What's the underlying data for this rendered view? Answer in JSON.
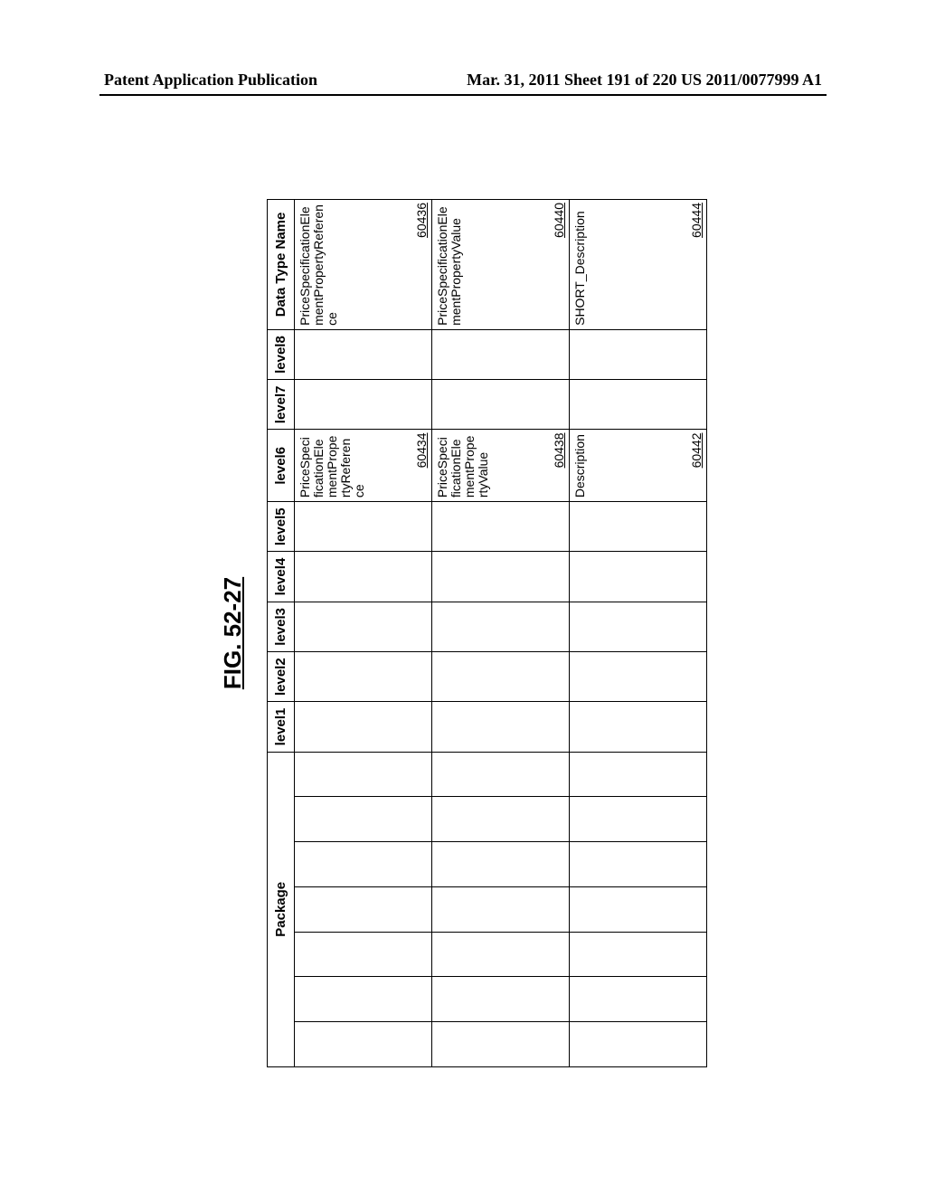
{
  "header": {
    "left": "Patent Application Publication",
    "right": "Mar. 31, 2011  Sheet 191 of 220   US 2011/0077999 A1"
  },
  "figure_title": "FIG. 52-27",
  "columns": {
    "package": "Package",
    "level1": "level1",
    "level2": "level2",
    "level3": "level3",
    "level4": "level4",
    "level5": "level5",
    "level6": "level6",
    "level7": "level7",
    "level8": "level8",
    "data_type_name": "Data Type Name"
  },
  "rows": [
    {
      "level6": {
        "text": "PriceSpecificationElementPropertyReference",
        "ref": "60434"
      },
      "data_type_name": {
        "text": "PriceSpecificationElementPropertyReference",
        "ref": "60436"
      }
    },
    {
      "level6": {
        "text": "PriceSpecificationElementPropertyValue",
        "ref": "60438"
      },
      "data_type_name": {
        "text": "PriceSpecificationElementPropertyValue",
        "ref": "60440"
      }
    },
    {
      "level6": {
        "text": "Description",
        "ref": "60442"
      },
      "data_type_name": {
        "text": "SHORT_Description",
        "ref": "60444"
      }
    }
  ]
}
